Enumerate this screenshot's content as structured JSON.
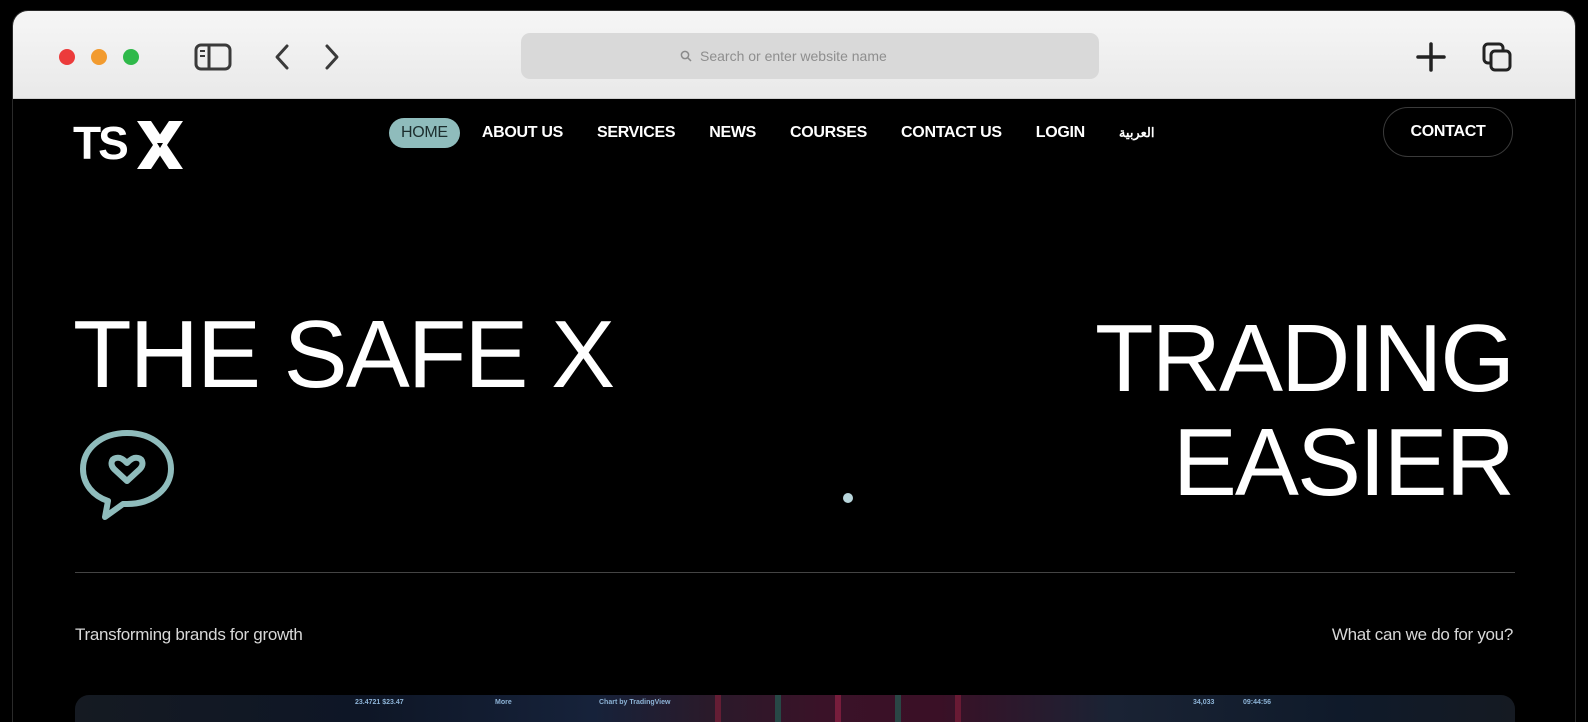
{
  "browser": {
    "address_placeholder": "Search or enter website name"
  },
  "site": {
    "logo_text": "TSX",
    "nav": [
      {
        "label": "HOME",
        "active": true
      },
      {
        "label": "ABOUT US"
      },
      {
        "label": "SERVICES"
      },
      {
        "label": "NEWS"
      },
      {
        "label": "COURSES"
      },
      {
        "label": "CONTACT US"
      },
      {
        "label": "LOGIN"
      },
      {
        "label": "العربية"
      }
    ],
    "contact_button": "CONTACT",
    "hero": {
      "left_heading": "THE SAFE X",
      "right_line1": "TRADING",
      "right_line2": "EASIER"
    },
    "tagline_left": "Transforming brands for growth",
    "tagline_right": "What can we do for you?",
    "preview": {
      "label1": "23.4721 $23.47",
      "label2": "More",
      "label3": "Chart by TradingView",
      "label4": "34,033",
      "label5": "09:44:56"
    }
  },
  "colors": {
    "accent": "#8fbcbc",
    "background": "#000000",
    "dot": "#b9d6dc"
  }
}
